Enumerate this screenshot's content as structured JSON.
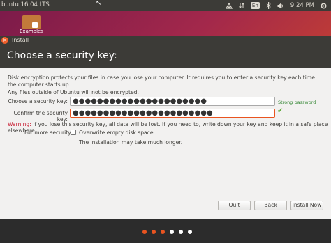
{
  "top_panel": {
    "title": "buntu 16.04 LTS",
    "keyboard_layout": "En",
    "clock": "9:24 PM"
  },
  "desktop": {
    "icon_label": "Examples"
  },
  "window": {
    "title": "Install",
    "heading": "Choose a security key:",
    "intro_text": "Disk encryption protects your files in case you lose your computer. It requires you to enter a security key each time the computer starts up.",
    "note_text": "Any files outside of Ubuntu will not be encrypted.",
    "key_label": "Choose a security key:",
    "key_value": "●●●●●●●●●●●●●●●●●●●●●●",
    "strength_text": "Strong password",
    "confirm_label": "Confirm the security key:",
    "confirm_value": "●●●●●●●●●●●●●●●●●●●●●●●",
    "warning_label": "Warning:",
    "warning_text": " If you lose this security key, all data will be lost. If you need to, write down your key and keep it in a safe place elsewhere.",
    "more_security_label": "For more security:",
    "overwrite_label": "Overwrite empty disk space",
    "overwrite_checked": false,
    "slow_note": "The installation may take much longer."
  },
  "buttons": {
    "quit": "Quit",
    "back": "Back",
    "install": "Install Now"
  },
  "progress": {
    "completed_steps": 3,
    "total_steps": 6
  },
  "colors": {
    "accent": "#e95420",
    "panel": "#3c3b37",
    "strength": "#3a8a3a"
  }
}
